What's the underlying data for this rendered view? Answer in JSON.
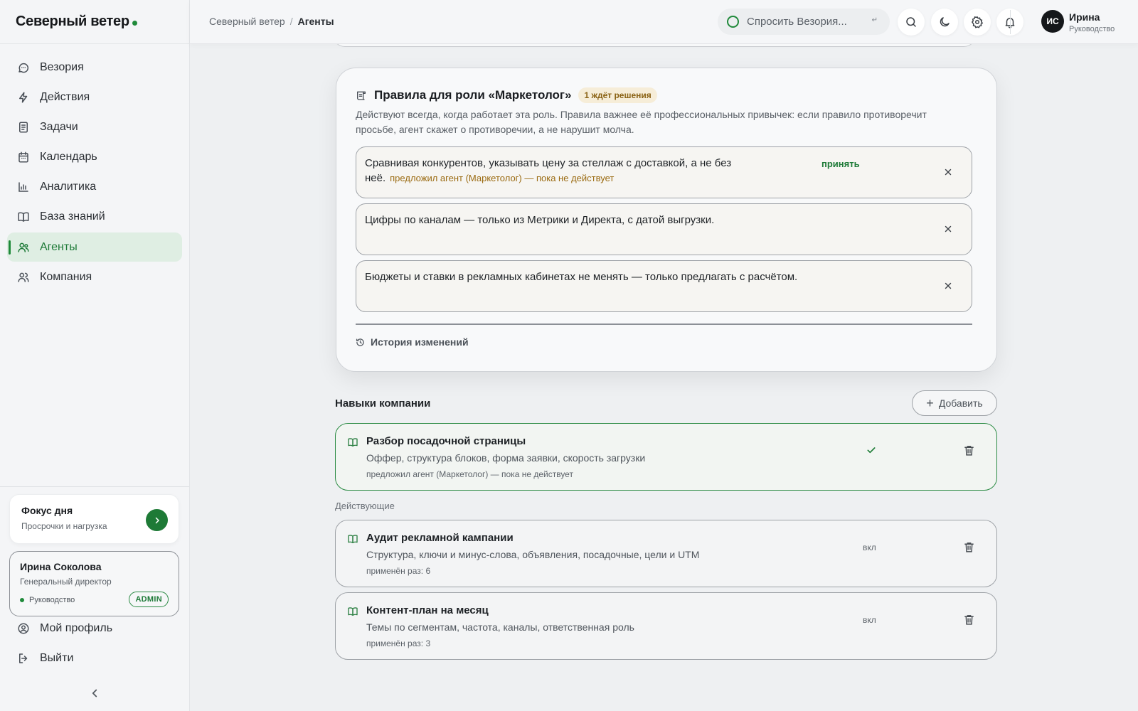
{
  "brand": {
    "name": "Северный ветер"
  },
  "nav": {
    "items": [
      {
        "label": "Везория",
        "icon": "chat-icon"
      },
      {
        "label": "Действия",
        "icon": "lightning-icon"
      },
      {
        "label": "Задачи",
        "icon": "tasks-icon"
      },
      {
        "label": "Календарь",
        "icon": "calendar-icon"
      },
      {
        "label": "Аналитика",
        "icon": "chart-icon"
      },
      {
        "label": "База знаний",
        "icon": "book-icon"
      },
      {
        "label": "Агенты",
        "icon": "agents-icon",
        "active": true
      },
      {
        "label": "Компания",
        "icon": "company-icon"
      }
    ]
  },
  "focus": {
    "title": "Фокус дня",
    "subtitle": "Просрочки и нагрузка"
  },
  "user_card": {
    "name": "Ирина Соколова",
    "position": "Генеральный директор",
    "role": "Руководство",
    "badge": "ADMIN"
  },
  "side_links": {
    "profile": "Мой профиль",
    "logout": "Выйти"
  },
  "breadcrumb": {
    "root": "Северный ветер",
    "separator": "/",
    "current": "Агенты"
  },
  "topbar": {
    "ask_placeholder": "Спросить Везория...",
    "enter_hint": "↵",
    "avatar_initials": "ИС",
    "user_name": "Ирина",
    "user_role": "Руководство"
  },
  "rules": {
    "title": "Правила для роли «Маркетолог»",
    "pending_badge": "1 ждёт решения",
    "description": "Действуют всегда, когда работает эта роль. Правила важнее её профессиональных привычек: если правило противоречит просьбе, агент скажет о противоречии, а не нарушит молча.",
    "items": [
      {
        "text": "Сравнивая конкурентов, указывать цену за стеллаж с доставкой, а не без неё.",
        "meta": "предложил агент (Маркетолог) — пока не действует",
        "accept_label": "принять"
      },
      {
        "text": "Цифры по каналам — только из Метрики и Директа, с датой выгрузки."
      },
      {
        "text": "Бюджеты и ставки в рекламных кабинетах не менять — только предлагать с расчётом."
      }
    ],
    "history_label": "История изменений"
  },
  "skills": {
    "title": "Навыки компании",
    "add_label": "Добавить",
    "pending": {
      "name": "Разбор посадочной страницы",
      "description": "Оффер, структура блоков, форма заявки, скорость загрузки",
      "note": "предложил агент (Маркетолог) — пока не действует"
    },
    "active_group_label": "Действующие",
    "active": [
      {
        "name": "Аудит рекламной кампании",
        "description": "Структура, ключи и минус-слова, объявления, посадочные, цели и UTM",
        "note": "применён раз: 6",
        "state": "вкл"
      },
      {
        "name": "Контент-план на месяц",
        "description": "Темы по сегментам, частота, каналы, ответственная роль",
        "note": "применён раз: 3",
        "state": "вкл"
      }
    ]
  },
  "colors": {
    "accent": "#1f8a3a",
    "pending": "#9a6a10",
    "pending_bg": "#f6edd8"
  }
}
